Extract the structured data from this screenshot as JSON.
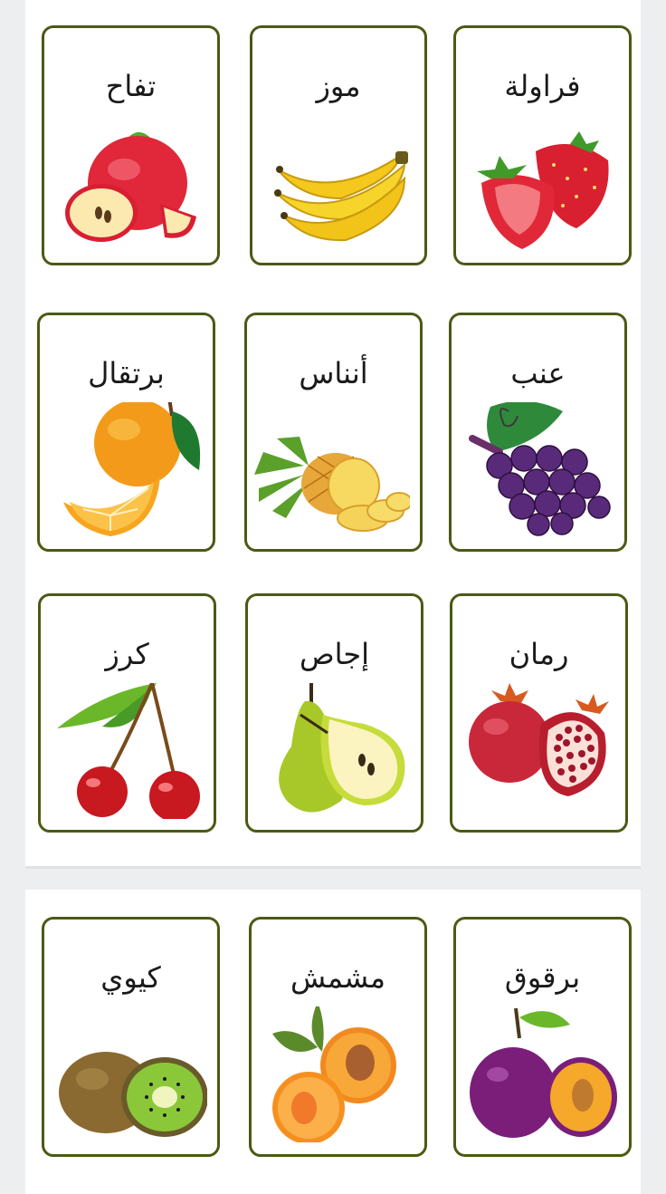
{
  "cards": [
    {
      "label": "تفاح",
      "icon": "apple-icon"
    },
    {
      "label": "موز",
      "icon": "banana-icon"
    },
    {
      "label": "فراولة",
      "icon": "strawberry-icon"
    },
    {
      "label": "برتقال",
      "icon": "orange-icon"
    },
    {
      "label": "أنناس",
      "icon": "pineapple-icon"
    },
    {
      "label": "عنب",
      "icon": "grapes-icon"
    },
    {
      "label": "كرز",
      "icon": "cherry-icon"
    },
    {
      "label": "إجاص",
      "icon": "pear-icon"
    },
    {
      "label": "رمان",
      "icon": "pomegranate-icon"
    },
    {
      "label": "كيوي",
      "icon": "kiwi-icon"
    },
    {
      "label": "مشمش",
      "icon": "apricot-icon"
    },
    {
      "label": "برقوق",
      "icon": "plum-icon"
    }
  ],
  "colors": {
    "card_border": "#4a5a14",
    "page_background": "#eceef0"
  }
}
